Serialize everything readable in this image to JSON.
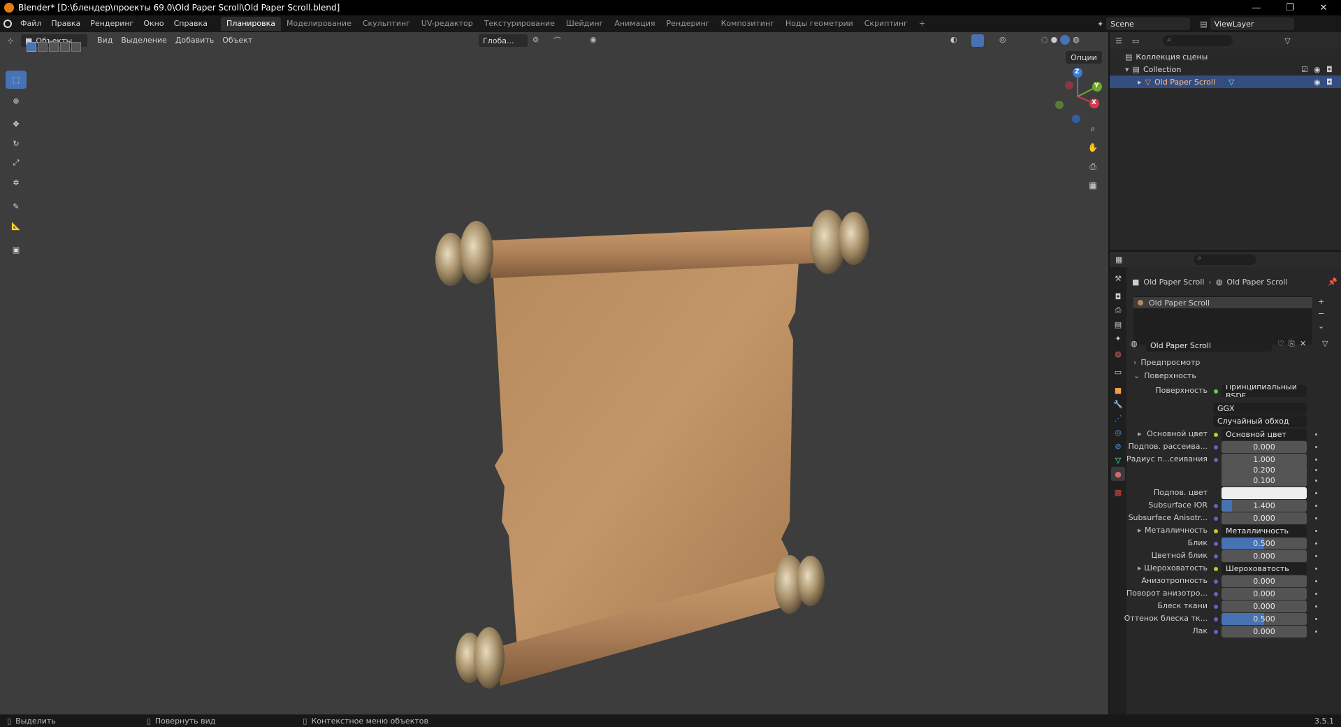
{
  "window": {
    "title": "Blender* [D:\\блендер\\проекты 69.0\\Old Paper Scroll\\Old Paper Scroll.blend]",
    "minimize": "—",
    "maximize": "❐",
    "close": "✕"
  },
  "topbar": {
    "menus": [
      "Файл",
      "Правка",
      "Рендеринг",
      "Окно",
      "Справка"
    ],
    "workspaces": [
      "Планировка",
      "Моделирование",
      "Скульптинг",
      "UV-редактор",
      "Текстурирование",
      "Шейдинг",
      "Анимация",
      "Рендеринг",
      "Композитинг",
      "Ноды геометрии",
      "Скриптинг"
    ],
    "active_workspace": "Планировка",
    "add_tab": "+",
    "scene": "Scene",
    "view_layer": "ViewLayer"
  },
  "viewport": {
    "mode": "Объекты",
    "menus": [
      "Вид",
      "Выделение",
      "Добавить",
      "Объект"
    ],
    "transform_orientation": "Глоба...",
    "options": "Опции",
    "gizmo_axes": {
      "z": "Z",
      "y": "Y",
      "x": "X"
    }
  },
  "outliner": {
    "scene_collection": "Коллекция сцены",
    "collection": "Collection",
    "object": "Old Paper Scroll"
  },
  "properties": {
    "breadcrumb_object": "Old Paper Scroll",
    "breadcrumb_material": "Old Paper Scroll",
    "material_slot": "Old Paper Scroll",
    "material_name": "Old Paper Scroll",
    "sections": {
      "preview": "Предпросмотр",
      "surface": "Поверхность"
    },
    "surface_label": "Поверхность",
    "surface_value": "Принципиальный BSDF",
    "distribution": "GGX",
    "subsurface_method": "Случайный обход",
    "rows": [
      {
        "label": "Основной цвет",
        "value": "Основной цвет",
        "kind": "link"
      },
      {
        "label": "Подпов. рассеива...",
        "value": "0.000",
        "kind": "num"
      },
      {
        "label": "Радиус п...сеивания",
        "value": "1.000",
        "kind": "num"
      },
      {
        "label": "",
        "value": "0.200",
        "kind": "num"
      },
      {
        "label": "",
        "value": "0.100",
        "kind": "num"
      },
      {
        "label": "Подпов. цвет",
        "value": "",
        "kind": "color"
      },
      {
        "label": "Subsurface IOR",
        "value": "1.400",
        "kind": "num"
      },
      {
        "label": "Subsurface Anisotr...",
        "value": "0.000",
        "kind": "num"
      },
      {
        "label": "Металличность",
        "value": "Металличность",
        "kind": "link"
      },
      {
        "label": "Блик",
        "value": "0.500",
        "kind": "num"
      },
      {
        "label": "Цветной блик",
        "value": "0.000",
        "kind": "num"
      },
      {
        "label": "Шероховатость",
        "value": "Шероховатость",
        "kind": "link"
      },
      {
        "label": "Анизотропность",
        "value": "0.000",
        "kind": "num"
      },
      {
        "label": "Поворот анизотро...",
        "value": "0.000",
        "kind": "num"
      },
      {
        "label": "Блеск ткани",
        "value": "0.000",
        "kind": "num"
      },
      {
        "label": "Оттенок блеска тк...",
        "value": "0.500",
        "kind": "num"
      },
      {
        "label": "Лак",
        "value": "0.000",
        "kind": "num"
      }
    ],
    "row_fills": [
      0,
      0,
      0,
      0,
      0,
      0,
      0.12,
      0,
      0,
      0.5,
      0,
      0,
      0,
      0,
      0,
      0.5,
      0
    ]
  },
  "statusbar": {
    "select": "Выделить",
    "rotate": "Повернуть вид",
    "context": "Контекстное меню объектов",
    "version": "3.5.1"
  },
  "colors": {
    "accent": "#4772b3",
    "selection": "#334d80",
    "paper": "#b98a5c",
    "brass": "#a8916b"
  }
}
